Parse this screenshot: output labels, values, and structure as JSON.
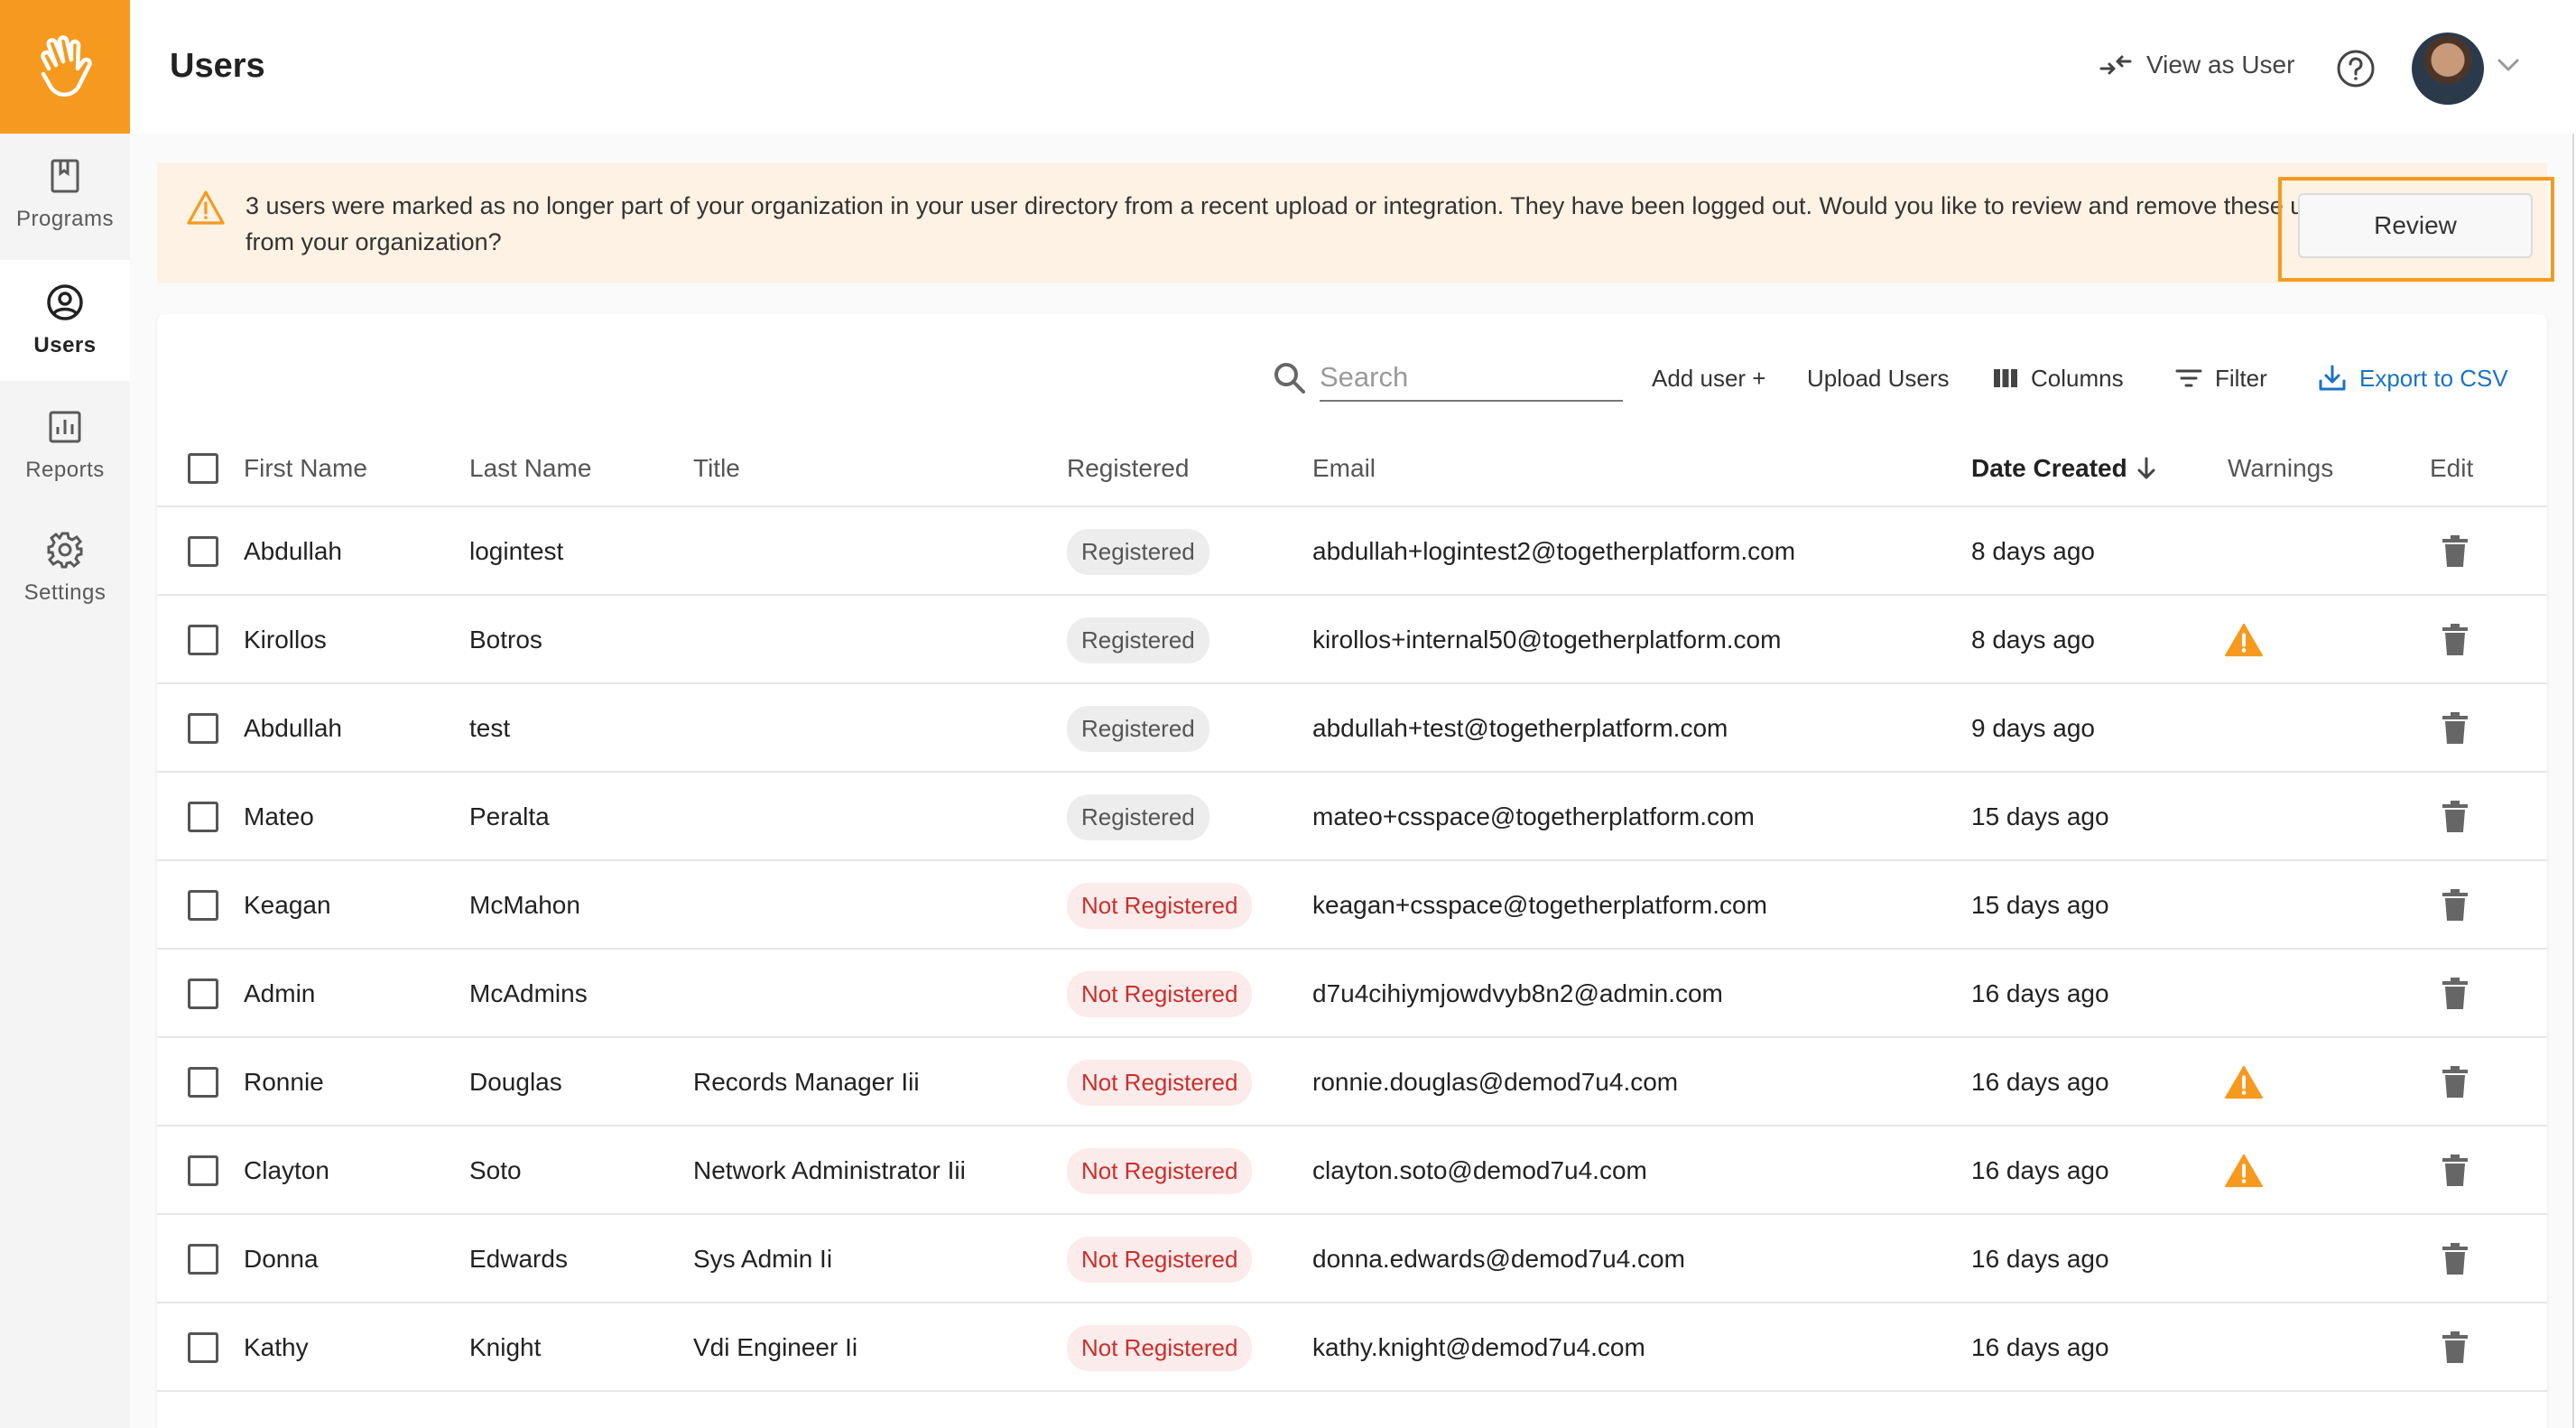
{
  "app": {
    "page_title": "Users"
  },
  "sidebar": {
    "items": [
      {
        "label": "Programs",
        "icon": "book-icon",
        "active": false
      },
      {
        "label": "Users",
        "icon": "user-circle-icon",
        "active": true
      },
      {
        "label": "Reports",
        "icon": "bar-chart-icon",
        "active": false
      },
      {
        "label": "Settings",
        "icon": "gear-icon",
        "active": false
      }
    ]
  },
  "header": {
    "view_as_label": "View as User",
    "help_icon": "help-circle-icon",
    "avatar_icon": "avatar"
  },
  "banner": {
    "message": "3 users were marked as no longer part of your organization in your user directory from a recent upload or integration. They have been logged out. Would you like to review and remove these users from your organization?",
    "review_label": "Review",
    "warning_color": "#f59a1f"
  },
  "toolbar": {
    "search_placeholder": "Search",
    "add_user_label": "Add user +",
    "upload_label": "Upload Users",
    "columns_label": "Columns",
    "filter_label": "Filter",
    "export_label": "Export to CSV"
  },
  "table": {
    "columns": {
      "first_name": "First Name",
      "last_name": "Last Name",
      "title": "Title",
      "registered": "Registered",
      "email": "Email",
      "date_created": "Date Created",
      "warnings": "Warnings",
      "edit": "Edit"
    },
    "rows": [
      {
        "first": "Abdullah",
        "last": "logintest",
        "title": "",
        "status": "Registered",
        "email": "abdullah+logintest2@togetherplatform.com",
        "created": "8 days ago",
        "warning": false
      },
      {
        "first": "Kirollos",
        "last": "Botros",
        "title": "",
        "status": "Registered",
        "email": "kirollos+internal50@togetherplatform.com",
        "created": "8 days ago",
        "warning": true
      },
      {
        "first": "Abdullah",
        "last": "test",
        "title": "",
        "status": "Registered",
        "email": "abdullah+test@togetherplatform.com",
        "created": "9 days ago",
        "warning": false
      },
      {
        "first": "Mateo",
        "last": "Peralta",
        "title": "",
        "status": "Registered",
        "email": "mateo+csspace@togetherplatform.com",
        "created": "15 days ago",
        "warning": false
      },
      {
        "first": "Keagan",
        "last": "McMahon",
        "title": "",
        "status": "Not Registered",
        "email": "keagan+csspace@togetherplatform.com",
        "created": "15 days ago",
        "warning": false
      },
      {
        "first": "Admin",
        "last": "McAdmins",
        "title": "",
        "status": "Not Registered",
        "email": "d7u4cihiymjowdvyb8n2@admin.com",
        "created": "16 days ago",
        "warning": false
      },
      {
        "first": "Ronnie",
        "last": "Douglas",
        "title": "Records Manager Iii",
        "status": "Not Registered",
        "email": "ronnie.douglas@demod7u4.com",
        "created": "16 days ago",
        "warning": true
      },
      {
        "first": "Clayton",
        "last": "Soto",
        "title": "Network Administrator Iii",
        "status": "Not Registered",
        "email": "clayton.soto@demod7u4.com",
        "created": "16 days ago",
        "warning": true
      },
      {
        "first": "Donna",
        "last": "Edwards",
        "title": "Sys Admin Ii",
        "status": "Not Registered",
        "email": "donna.edwards@demod7u4.com",
        "created": "16 days ago",
        "warning": false
      },
      {
        "first": "Kathy",
        "last": "Knight",
        "title": "Vdi Engineer Ii",
        "status": "Not Registered",
        "email": "kathy.knight@demod7u4.com",
        "created": "16 days ago",
        "warning": false
      }
    ]
  },
  "colors": {
    "brand": "#f59a1f",
    "link": "#1a73c9",
    "not_registered": "#c9302c"
  }
}
